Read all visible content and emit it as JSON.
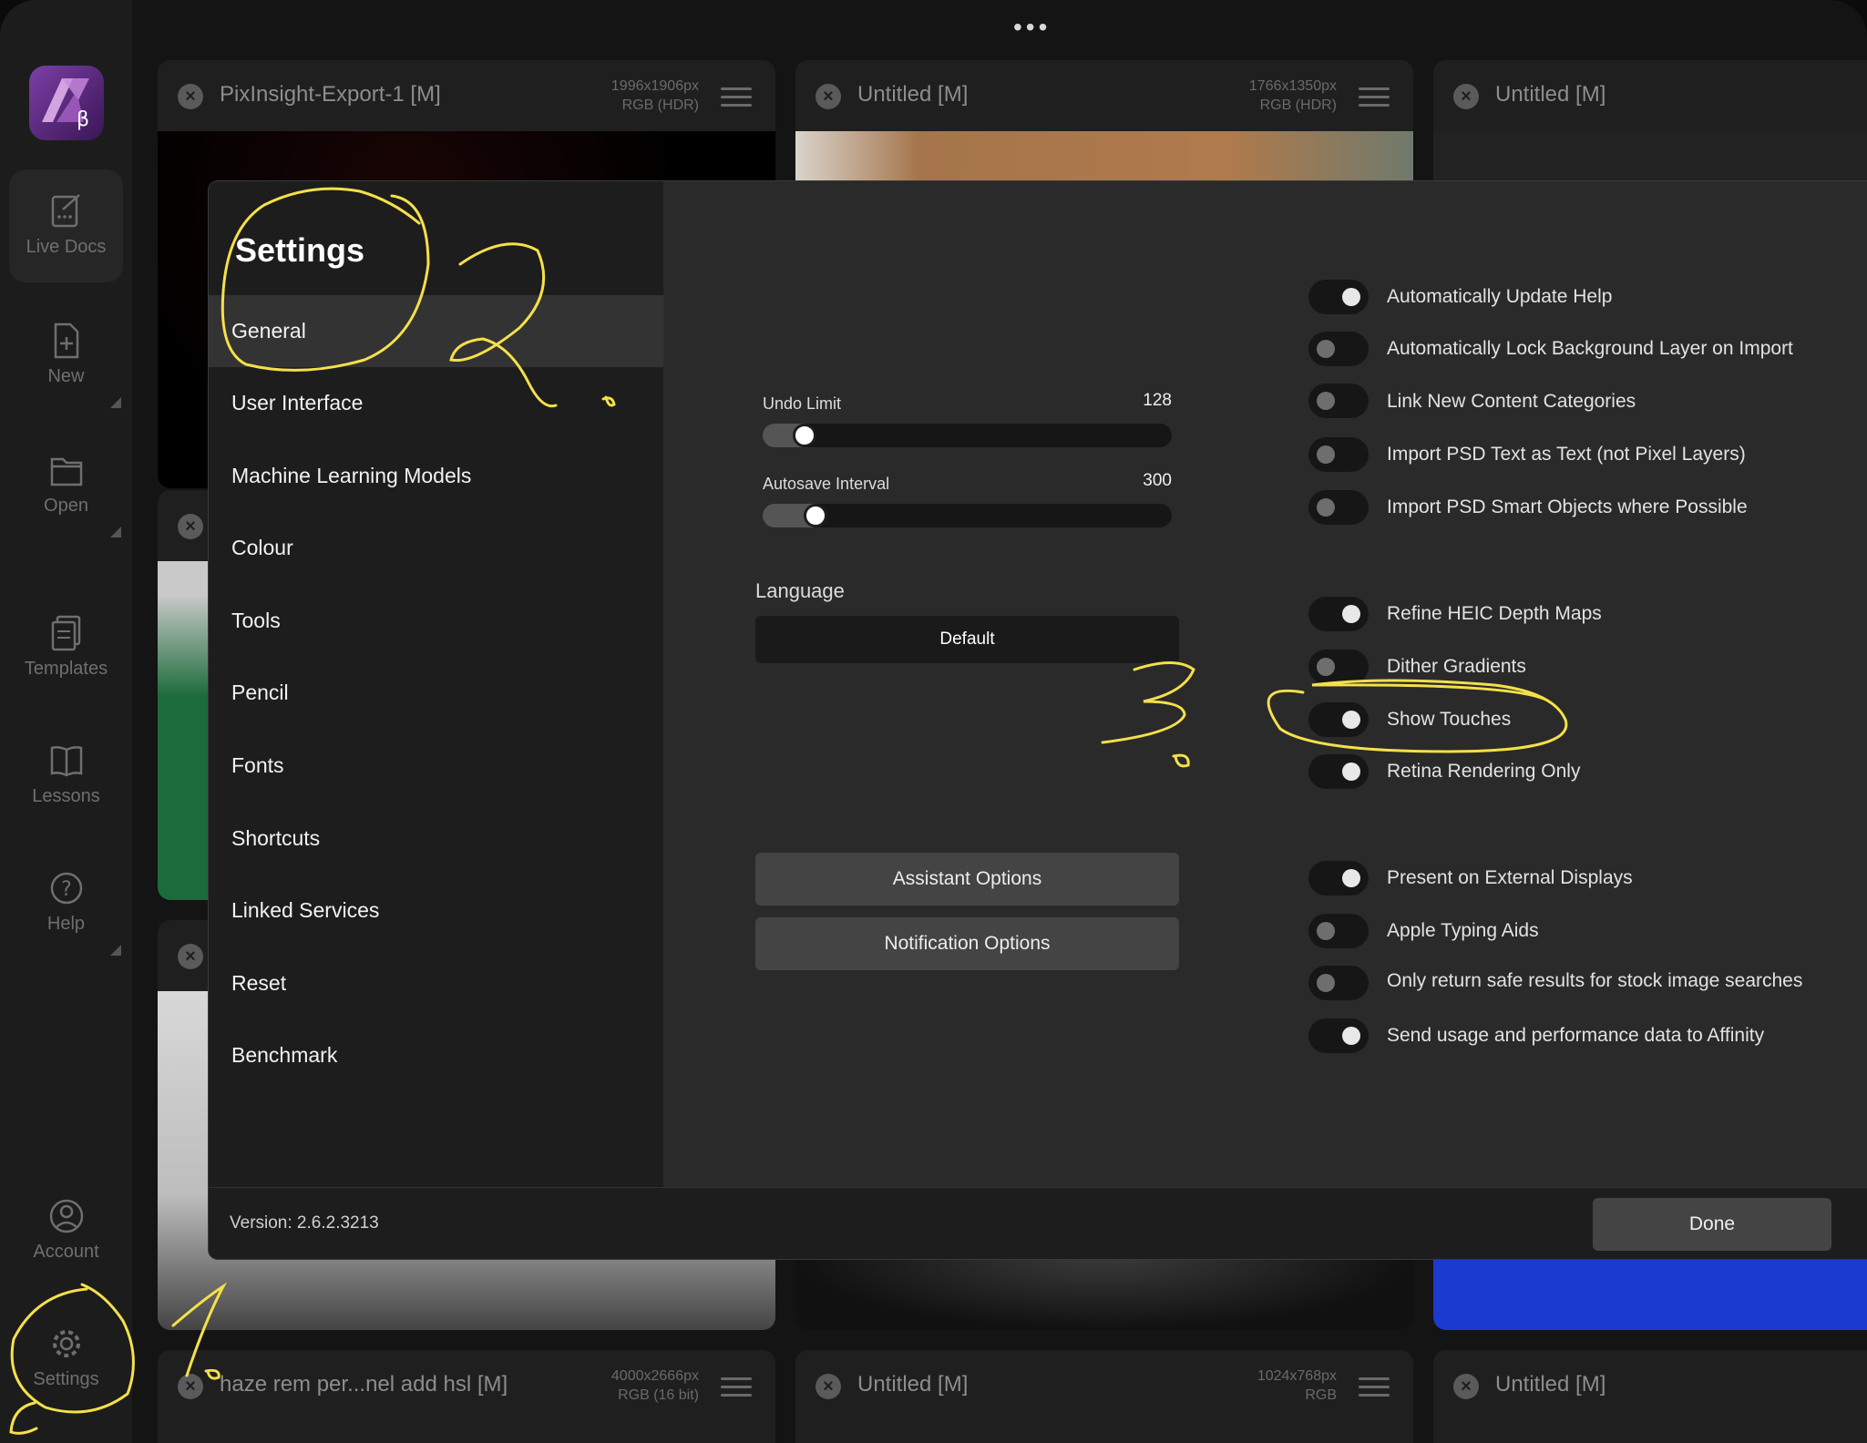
{
  "window": {
    "more_dots": "•••"
  },
  "sidebar": {
    "items": [
      {
        "label": "Live Docs"
      },
      {
        "label": "New"
      },
      {
        "label": "Open"
      },
      {
        "label": "Templates"
      },
      {
        "label": "Lessons"
      },
      {
        "label": "Help"
      },
      {
        "label": "Account"
      },
      {
        "label": "Settings"
      }
    ]
  },
  "documents": [
    {
      "title": "PixInsight-Export-1 [M]",
      "size": "1996x1906px",
      "format": "RGB (HDR)"
    },
    {
      "title": "Untitled [M]",
      "size": "1766x1350px",
      "format": "RGB (HDR)"
    },
    {
      "title": "Untitled [M]"
    },
    {
      "title": "haze rem per...nel add hsl [M]",
      "size": "4000x2666px",
      "format": "RGB (16 bit)"
    },
    {
      "title": "Untitled [M]",
      "size": "1024x768px",
      "format": "RGB"
    },
    {
      "title": "Untitled [M]"
    }
  ],
  "settings": {
    "title": "Settings",
    "nav": [
      {
        "label": "General"
      },
      {
        "label": "User Interface"
      },
      {
        "label": "Machine Learning Models"
      },
      {
        "label": "Colour"
      },
      {
        "label": "Tools"
      },
      {
        "label": "Pencil"
      },
      {
        "label": "Fonts"
      },
      {
        "label": "Shortcuts"
      },
      {
        "label": "Linked Services"
      },
      {
        "label": "Reset"
      },
      {
        "label": "Benchmark"
      }
    ],
    "undo_limit": {
      "label": "Undo Limit",
      "value": "128",
      "fraction": 0.06
    },
    "autosave": {
      "label": "Autosave Interval",
      "value": "300",
      "fraction": 0.09
    },
    "language": {
      "label": "Language",
      "value": "Default"
    },
    "assistant_button": "Assistant Options",
    "notification_button": "Notification Options",
    "toggles": [
      {
        "label": "Automatically Update Help",
        "on": true
      },
      {
        "label": "Automatically Lock Background Layer on Import",
        "on": false
      },
      {
        "label": "Link New Content Categories",
        "on": false
      },
      {
        "label": "Import PSD Text as Text (not Pixel Layers)",
        "on": false
      },
      {
        "label": "Import PSD Smart Objects where Possible",
        "on": false
      },
      {
        "label": "Refine HEIC Depth Maps",
        "on": true
      },
      {
        "label": "Dither Gradients",
        "on": false
      },
      {
        "label": "Show Touches",
        "on": true
      },
      {
        "label": "Retina Rendering Only",
        "on": true
      },
      {
        "label": "Present on External Displays",
        "on": true
      },
      {
        "label": "Apple Typing Aids",
        "on": false
      },
      {
        "label": "Only return safe results for stock image searches",
        "on": false
      },
      {
        "label": "Send usage and performance data to Affinity",
        "on": true
      }
    ],
    "version": "Version: 2.6.2.3213",
    "done_button": "Done"
  },
  "colors": {
    "annotation": "#f5e04a",
    "accent": "#7b3fa6"
  }
}
